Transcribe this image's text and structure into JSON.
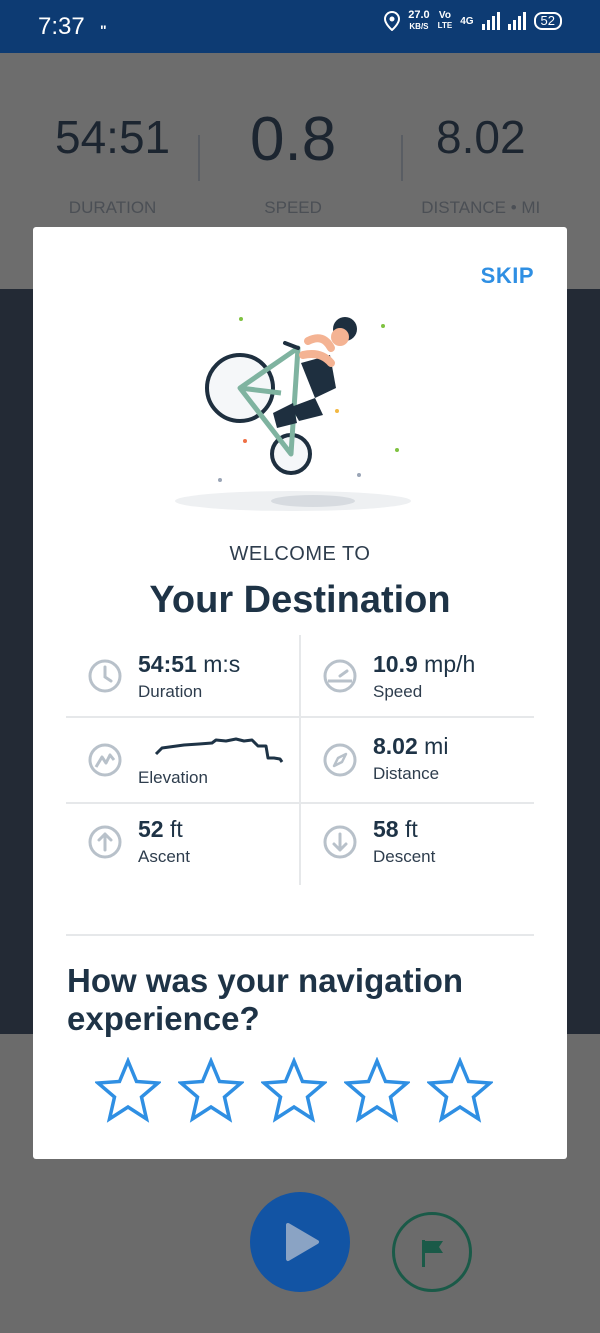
{
  "status_bar": {
    "time": "7:37",
    "notification_dots": "\"",
    "net_speed_value": "27.0",
    "net_speed_unit": "KB/S",
    "volte_line1": "Vo",
    "volte_line2": "LTE",
    "network": "4G",
    "battery": "52"
  },
  "background": {
    "stats": [
      {
        "value": "54:51",
        "label": "DURATION"
      },
      {
        "value": "0.8",
        "label": "SPEED"
      },
      {
        "value": "8.02",
        "label": "DISTANCE • MI"
      }
    ]
  },
  "modal": {
    "skip_label": "SKIP",
    "welcome": "WELCOME TO",
    "destination": "Your Destination",
    "stats": {
      "duration": {
        "value": "54:51",
        "unit": "m:s",
        "label": "Duration"
      },
      "speed": {
        "value": "10.9",
        "unit": "mp/h",
        "label": "Speed"
      },
      "elevation": {
        "label": "Elevation"
      },
      "distance": {
        "value": "8.02",
        "unit": "mi",
        "label": "Distance"
      },
      "ascent": {
        "value": "52",
        "unit": "ft",
        "label": "Ascent"
      },
      "descent": {
        "value": "58",
        "unit": "ft",
        "label": "Descent"
      }
    },
    "question": "How was your navigation experience?",
    "rating": {
      "max": 5,
      "selected": 0
    }
  },
  "colors": {
    "status_bar": "#0d3b73",
    "accent": "#2f8fe3",
    "text_dark": "#1e3346",
    "play_button": "#1254a4",
    "flag_button": "#1a5a48"
  }
}
